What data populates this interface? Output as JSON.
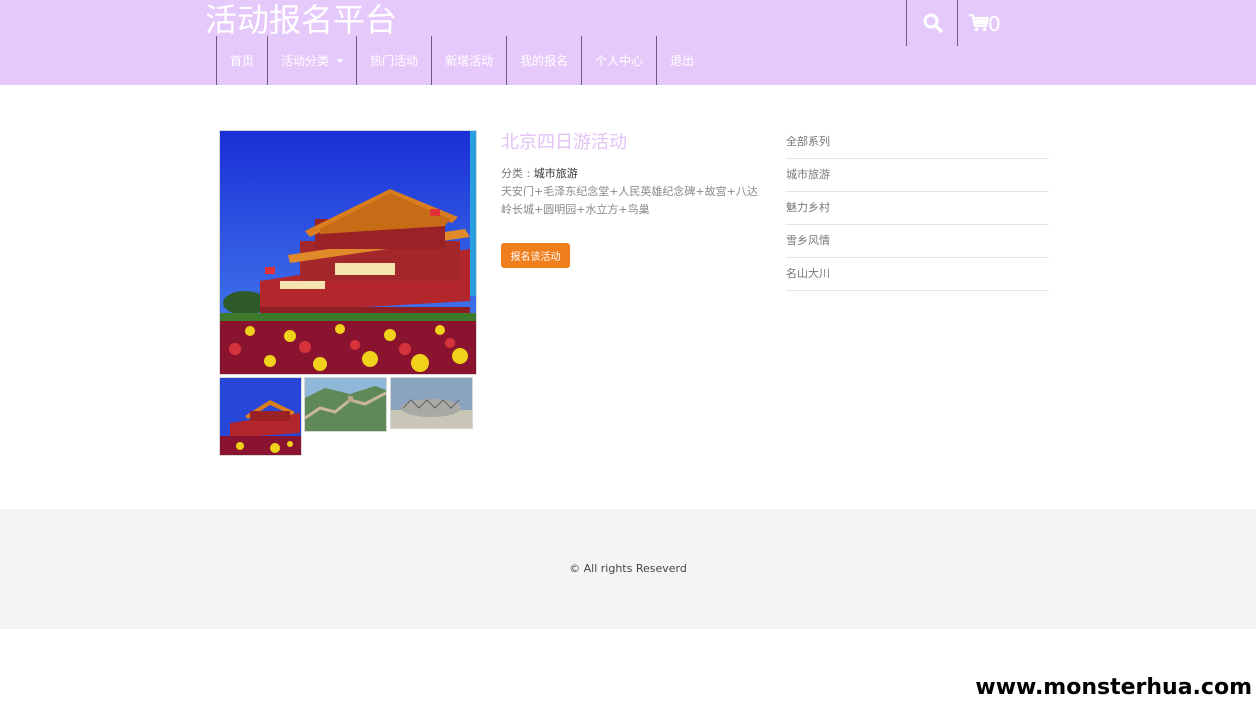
{
  "header": {
    "site_title": "活动报名平台",
    "cart_count": "0",
    "nav": [
      "首页",
      "活动分类",
      "热门活动",
      "新增活动",
      "我的报名",
      "个人中心",
      "退出"
    ]
  },
  "event": {
    "title": "北京四日游活动",
    "category_label": "分类 :",
    "category_value": "城市旅游",
    "description": "天安门+毛泽东纪念堂+人民英雄纪念碑+故宫+八达岭长城+圆明园+水立方+鸟巢",
    "signup_label": "报名该活动"
  },
  "sidebar": {
    "items": [
      "全部系列",
      "城市旅游",
      "魅力乡村",
      "雪乡风情",
      "名山大川"
    ]
  },
  "footer": {
    "copyright": "© All rights Reseverd"
  },
  "watermark": "www.monsterhua.com",
  "colors": {
    "header_bg": "#e6c9fb",
    "title_accent": "#e2c3f7",
    "button_orange": "#f07e1d",
    "footer_bg": "#f3f4f6"
  }
}
